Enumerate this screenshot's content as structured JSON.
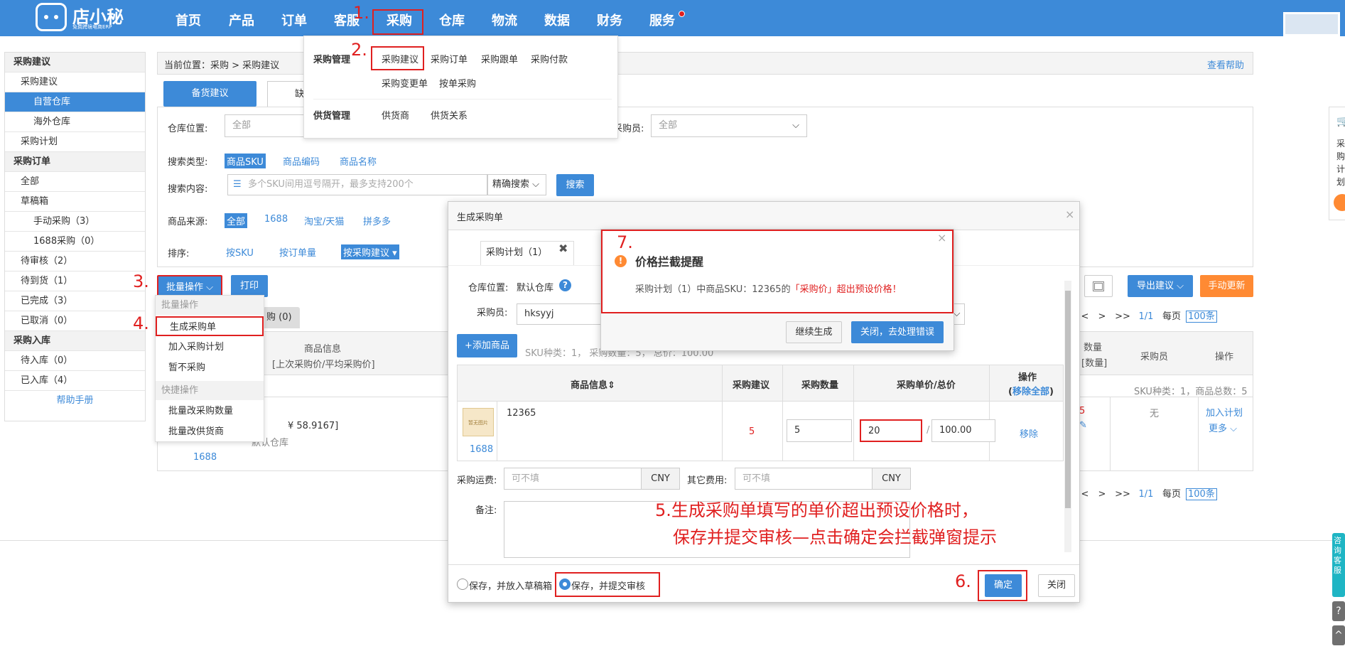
{
  "brand": {
    "name": "店小秘",
    "slogan": "免费跨境电商ERP"
  },
  "nav": [
    "首页",
    "产品",
    "订单",
    "客服",
    "采购",
    "仓库",
    "物流",
    "数据",
    "财务",
    "服务"
  ],
  "annotations": {
    "a1": "1.",
    "a2": "2.",
    "a3": "3.",
    "a4": "4.",
    "a6": "6.",
    "a7": "7.",
    "note_line1": "5.生成采购单填写的单价超出预设价格时，",
    "note_line2": "保存并提交审核—点击确定会拦截弹窗提示"
  },
  "purchase_menu": {
    "group1": "采购管理",
    "group1_items": [
      "采购建议",
      "采购订单",
      "采购跟单",
      "采购付款",
      "采购变更单",
      "按单采购"
    ],
    "group2": "供货管理",
    "group2_items": [
      "供货商",
      "供货关系"
    ]
  },
  "sidebar": [
    {
      "label": "采购建议",
      "type": "h"
    },
    {
      "label": "采购建议",
      "type": "l1"
    },
    {
      "label": "自营仓库",
      "type": "l2",
      "active": true
    },
    {
      "label": "海外仓库",
      "type": "l2"
    },
    {
      "label": "采购计划",
      "type": "l1"
    },
    {
      "label": "采购订单",
      "type": "h"
    },
    {
      "label": "全部",
      "type": "l1"
    },
    {
      "label": "草稿箱",
      "type": "l1"
    },
    {
      "label": "手动采购（3）",
      "type": "l2"
    },
    {
      "label": "1688采购（0）",
      "type": "l2"
    },
    {
      "label": "待审核（2）",
      "type": "l1"
    },
    {
      "label": "待到货（1）",
      "type": "l1"
    },
    {
      "label": "已完成（3）",
      "type": "l1"
    },
    {
      "label": "已取消（0）",
      "type": "l1"
    },
    {
      "label": "采购入库",
      "type": "h"
    },
    {
      "label": "待入库（0）",
      "type": "l1"
    },
    {
      "label": "已入库（4）",
      "type": "l1"
    },
    {
      "label": "帮助手册",
      "type": "help"
    }
  ],
  "breadcrumb": "当前位置：采购 > 采购建议",
  "help_link": "查看帮助",
  "tabs": {
    "active": "备货建议",
    "second": "缺"
  },
  "filters": {
    "warehouse_label": "仓库位置:",
    "warehouse_value": "全部",
    "buyer_label": "采购员:",
    "buyer_value": "全部",
    "search_type_label": "搜索类型:",
    "search_types": [
      "商品SKU",
      "商品编码",
      "商品名称"
    ],
    "search_content_label": "搜索内容:",
    "search_placeholder": "多个SKU间用逗号隔开，最多支持200个",
    "search_mode": "精确搜索",
    "search_button": "搜索",
    "source_label": "商品来源:",
    "sources": [
      "全部",
      "1688",
      "淘宝/天猫",
      "拼多多"
    ],
    "sort_label": "排序:",
    "sorts": [
      "按SKU",
      "按订单量",
      "按采购建议"
    ]
  },
  "toolbar": {
    "batch": "批量操作",
    "print": "打印",
    "export": "导出建议",
    "manual_update": "手动更新"
  },
  "batch_menu": {
    "sec1": "批量操作",
    "items1": [
      "生成采购单",
      "加入采购计划",
      "暂不采购"
    ],
    "sec2": "快捷操作",
    "items2": [
      "批量改采购数量",
      "批量改供货商"
    ]
  },
  "list_tab_fragment": "购 (0)",
  "main_table": {
    "col_product": "商品信息",
    "col_product_sub": "[上次采购价/平均采购价]",
    "col_qty_frag": "数量",
    "col_qty_frag2": "[数量]",
    "col_buyer": "采购员",
    "col_action": "操作",
    "summary": "SKU种类：1，商品总数：5",
    "row_price_frag": "¥ 58.9167]",
    "row_wh_frag": "默认仓库",
    "row_source": "1688",
    "row_num_frag": "5",
    "row_buyer": "无",
    "row_add_plan": "加入计划",
    "row_more": "更多"
  },
  "pager": {
    "first": "<",
    "prev": "<",
    "next": ">",
    "last": ">>",
    "page": "1/1",
    "per_page_label": "每页",
    "per_page": "100条"
  },
  "modal": {
    "title": "生成采购单",
    "tab": "采购计划（1）",
    "warehouse_label": "仓库位置:",
    "warehouse_value": "默认仓库",
    "buyer_label": "采购员:",
    "buyer_value": "hksyyj",
    "add_button": "+添加商品",
    "stats": "SKU种类：1，  采购数量：5，  总价：100.00",
    "cols": {
      "product": "商品信息",
      "suggest": "采购建议",
      "qty": "采购数量",
      "price": "采购单价/总价",
      "action": "操作",
      "remove_all": "移除全部"
    },
    "row": {
      "sku": "12365",
      "source": "1688",
      "img_text": "暂无图片",
      "suggest": "5",
      "qty": "5",
      "unit_price": "20",
      "total": "100.00",
      "remove": "移除"
    },
    "freight_label": "采购运费:",
    "freight_placeholder": "可不填",
    "currency": "CNY",
    "other_label": "其它费用:",
    "other_placeholder": "可不填",
    "remark_label": "备注:",
    "radio1": "保存，并放入草稿箱",
    "radio2": "保存，并提交审核",
    "confirm": "确定",
    "close": "关闭"
  },
  "alert": {
    "title": "价格拦截提醒",
    "message_pre": "采购计划（1）中商品SKU：12365的",
    "message_red": "「采购价」超出预设价格！",
    "continue": "继续生成",
    "close_fix": "关闭，去处理错误"
  },
  "right_float": {
    "chars": [
      "采",
      "购",
      "计",
      "划"
    ],
    "consult": "咨询客服"
  },
  "colors": {
    "primary": "#3d8ad8",
    "accent": "#ff8a33",
    "annotation": "#e02020"
  }
}
